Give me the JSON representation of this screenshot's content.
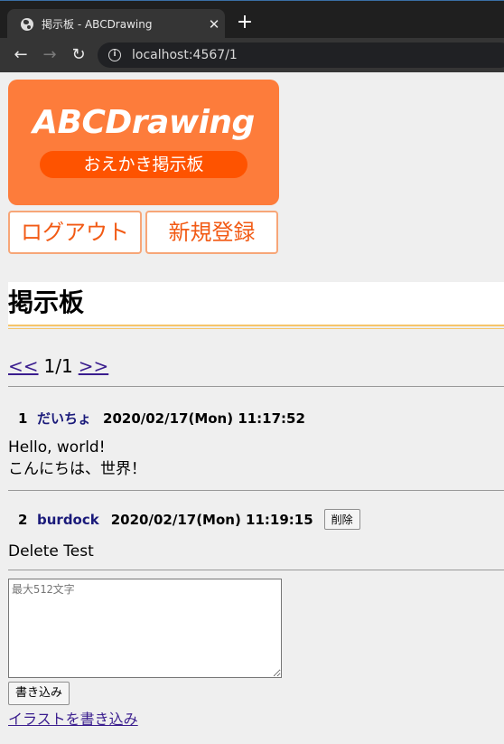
{
  "browser": {
    "tab_title": "掲示板 - ABCDrawing",
    "close_glyph": "✕",
    "new_tab_glyph": "+",
    "back_glyph": "←",
    "forward_glyph": "→",
    "reload_glyph": "↻",
    "info_glyph": "i",
    "url": "localhost:4567/1"
  },
  "logo": {
    "brand": "ABCDrawing",
    "subtitle": "おえかき掲示板"
  },
  "nav": {
    "logout": "ログアウト",
    "register": "新規登録"
  },
  "board": {
    "title": "掲示板"
  },
  "pager": {
    "prev": "<<",
    "current": "1/1",
    "next": ">>"
  },
  "posts": [
    {
      "number": "1",
      "name": "だいちょ",
      "date": "2020/02/17(Mon) 11:17:52",
      "lines": [
        "Hello, world!",
        "こんにちは、世界！"
      ]
    },
    {
      "number": "2",
      "name": "burdock",
      "date": "2020/02/17(Mon) 11:19:15",
      "delete_label": "削除",
      "lines": [
        "Delete Test"
      ]
    }
  ],
  "form": {
    "placeholder": "最大512文字",
    "submit": "書き込み",
    "illust_link": "イラストを書き込み"
  },
  "colors": {
    "logo_bg": "#fd7c3b",
    "logo_pill": "#fe5300",
    "accent_text": "#f25a14",
    "title_rule": "#f5c56a",
    "link": "#3a1d8e"
  }
}
